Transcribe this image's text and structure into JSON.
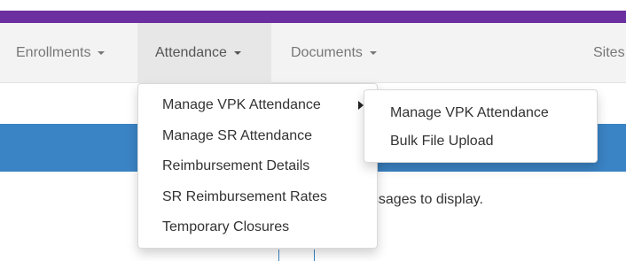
{
  "nav": {
    "enrollments": "Enrollments",
    "attendance": "Attendance",
    "documents": "Documents",
    "sites": "Sites"
  },
  "attendance_menu": {
    "items": [
      "Manage VPK Attendance",
      "Manage SR Attendance",
      "Reimbursement Details",
      "SR Reimbursement Rates",
      "Temporary Closures"
    ]
  },
  "vpk_submenu": {
    "items": [
      "Manage VPK Attendance",
      "Bulk File Upload"
    ]
  },
  "messages": {
    "text": "essages to display."
  },
  "colors": {
    "brand": "#6b2fa0",
    "banner": "#3a83c4",
    "navbar": "#f3f3f3",
    "nav_active": "#e7e7e7"
  }
}
